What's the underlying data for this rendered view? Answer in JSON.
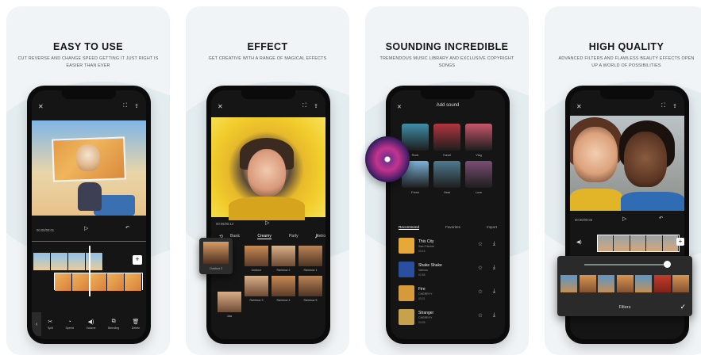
{
  "cards": [
    {
      "title": "EASY TO USE",
      "subtitle": "CUT REVERSE AND CHANGE SPEED GETTING IT JUST RIGHT IS EASIER THAN EVER",
      "time_label": "00:00/00:01",
      "tools": [
        {
          "label": "Split",
          "icon": "split-icon",
          "glyph": "✂"
        },
        {
          "label": "Speed",
          "icon": "speed-icon",
          "glyph": "◔"
        },
        {
          "label": "Volume",
          "icon": "volume-icon",
          "glyph": "◀)"
        },
        {
          "label": "Blending",
          "icon": "blending-icon",
          "glyph": "⧉"
        },
        {
          "label": "Delete",
          "icon": "delete-icon",
          "glyph": "🗑"
        }
      ]
    },
    {
      "title": "EFFECT",
      "subtitle": "GET CREATIVE WITH A RANGE OF MAGICAL EFFECTS",
      "time_label": "00:06/00:14",
      "filter_tabs": [
        "Basic",
        "Creamy",
        "Party",
        "Retro"
      ],
      "active_tab": "Creamy",
      "popup_filter": "Outdoor 2",
      "filters": [
        "Outdoor",
        "Rainbow 2",
        "Rainbow 1",
        "Rainbow 3",
        "Rainbow 4",
        "Rainbow 5",
        "Jaw"
      ]
    },
    {
      "title": "SOUNDING INCREDIBLE",
      "subtitle": "TREMENDOUS MUSIC LIBRARY AND EXCLUSIVE COPYRIGHT SONGS",
      "screen_title": "Add sound",
      "categories": [
        {
          "label": "Rock",
          "color": "#3f8fa8"
        },
        {
          "label": "Travel",
          "color": "#b3353f"
        },
        {
          "label": "Vlog",
          "color": "#c7566c"
        },
        {
          "label": "Fresh",
          "color": "#7db3d8"
        },
        {
          "label": "Heal",
          "color": "#4f7a8e"
        },
        {
          "label": "Love",
          "color": "#7a4e74"
        }
      ],
      "tabs": [
        "Recommend",
        "Favorites",
        "Import"
      ],
      "active_tab": "Recommend",
      "songs": [
        {
          "name": "This City",
          "artist": "Sam Fischer",
          "duration": "03:16",
          "art": "#e7a83a"
        },
        {
          "name": "Shake Shake",
          "artist": "Various",
          "duration": "02:55",
          "art": "#2b4fa0"
        },
        {
          "name": "Fire",
          "artist": "CHERRYY",
          "duration": "03:21",
          "art": "#d69a3b"
        },
        {
          "name": "Stranger",
          "artist": "CHERRYY",
          "duration": "03:05",
          "art": "#c7a24d"
        }
      ]
    },
    {
      "title": "HIGH QUALITY",
      "subtitle": "ADVANCED FILTERS AND FLAWLESS BEAUTY EFFECTS OPEN UP A WORLD OF POSSIBILITIES",
      "time_label": "00:00/00:03",
      "panel_label": "Filters",
      "slider_value": 1.0
    }
  ]
}
